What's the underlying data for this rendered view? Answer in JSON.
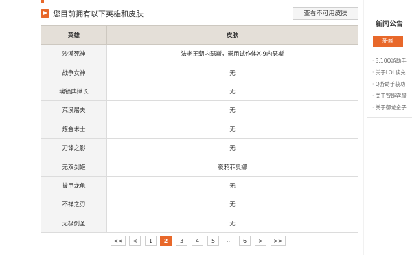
{
  "section": {
    "title": "您目前拥有以下英雄和皮肤",
    "unavailable_skins_button": "查看不可用皮肤"
  },
  "table": {
    "headers": {
      "hero": "英雄",
      "skin": "皮肤"
    },
    "rows": [
      {
        "hero": "沙漠死神",
        "skin": "法老王朝内瑟斯，鬱用试作体X-9内瑟斯"
      },
      {
        "hero": "战争女神",
        "skin": "无"
      },
      {
        "hero": "魂锁典狱长",
        "skin": "无"
      },
      {
        "hero": "荒漠屠夫",
        "skin": "无"
      },
      {
        "hero": "炼金术士",
        "skin": "无"
      },
      {
        "hero": "刀锋之影",
        "skin": "无"
      },
      {
        "hero": "无双剑姬",
        "skin": "夜鸦菲奥娜"
      },
      {
        "hero": "披甲龙龟",
        "skin": "无"
      },
      {
        "hero": "不祥之刃",
        "skin": "无"
      },
      {
        "hero": "无极剑圣",
        "skin": "无"
      }
    ]
  },
  "pagination": {
    "first": "<<",
    "prev": "<",
    "pages": [
      "1",
      "2",
      "3",
      "4",
      "5"
    ],
    "current": "2",
    "ellipsis": "...",
    "last_page": "6",
    "next": ">",
    "last": ">>"
  },
  "news": {
    "title": "新闻公告",
    "tab": "新闻",
    "items": [
      "3.10Q游助手",
      "关于LOL读充",
      "Q游助手获功",
      "关于智能客服",
      "关于御龙金子"
    ]
  },
  "colors": {
    "accent": "#e8682a",
    "table_header_bg": "#e4dfd8",
    "hero_cell_bg": "#f4f4f4"
  }
}
